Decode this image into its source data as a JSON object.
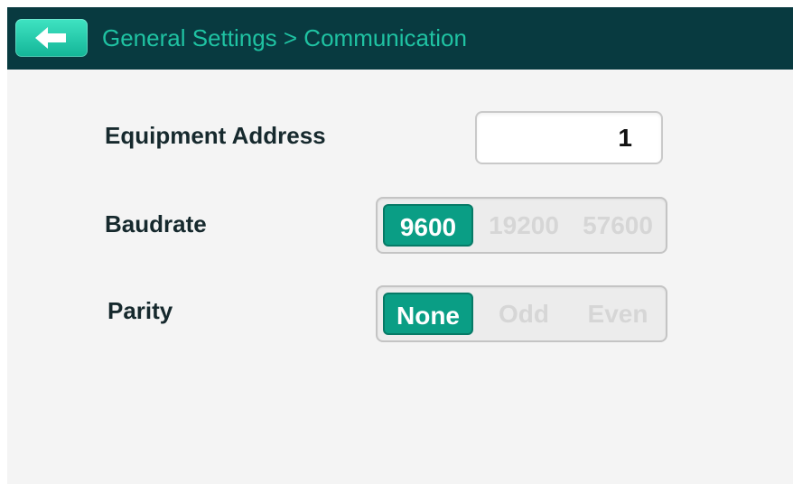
{
  "header": {
    "title": "General Settings > Communication",
    "back_icon": "back-arrow-icon"
  },
  "equipment_address": {
    "label": "Equipment Address",
    "value": "1"
  },
  "baudrate": {
    "label": "Baudrate",
    "options": [
      "9600",
      "19200",
      "57600"
    ],
    "selected": "9600"
  },
  "parity": {
    "label": "Parity",
    "options": [
      "None",
      "Odd",
      "Even"
    ],
    "selected": "None"
  },
  "colors": {
    "header_bg": "#083a40",
    "accent": "#1fc2a2",
    "selected_bg": "#0a9e85",
    "background": "#f4f4f4"
  }
}
